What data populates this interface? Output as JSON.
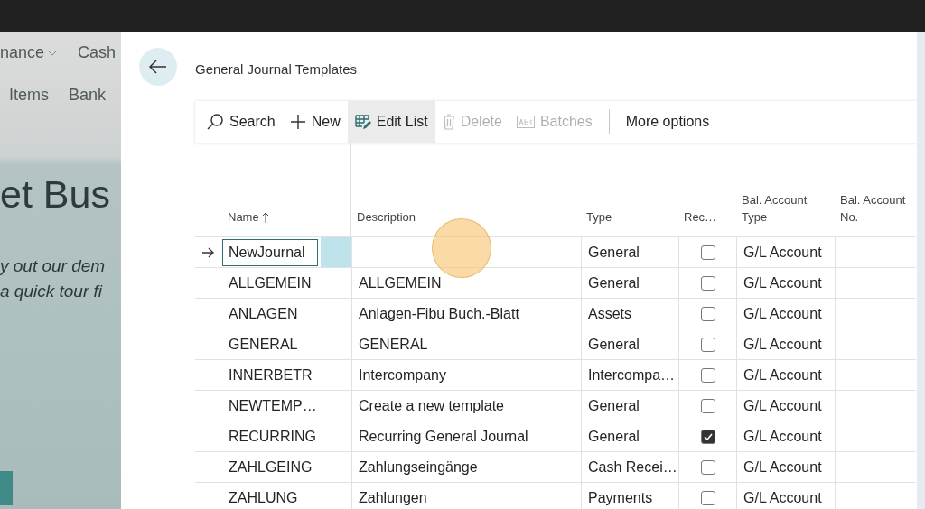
{
  "background": {
    "nav_top": [
      {
        "label": "nance",
        "dropdown": true
      },
      {
        "label": "Cash",
        "dropdown": false
      }
    ],
    "nav_bottom": [
      "Items",
      "Bank"
    ],
    "heading": "et Bus",
    "lines": [
      "y out our dem",
      "a quick tour fi"
    ]
  },
  "panel": {
    "title": "General Journal Templates",
    "toolbar": [
      {
        "label": "Search",
        "kind": "search",
        "disabled": false,
        "selected": false
      },
      {
        "label": "New",
        "kind": "new",
        "disabled": false,
        "selected": false
      },
      {
        "label": "Edit List",
        "kind": "edit",
        "disabled": false,
        "selected": true
      },
      {
        "label": "Delete",
        "kind": "delete",
        "disabled": true,
        "selected": false
      },
      {
        "label": "Batches",
        "kind": "batches",
        "disabled": true,
        "selected": false
      },
      {
        "label": "More options",
        "kind": "more",
        "disabled": false,
        "selected": false
      }
    ],
    "columns": [
      {
        "label": "Name",
        "sorted": true
      },
      {
        "label": "Description",
        "sorted": false
      },
      {
        "label": "Type",
        "sorted": false
      },
      {
        "label": "Rec…",
        "sorted": false
      },
      {
        "label": "Bal. Account Type",
        "sorted": false
      },
      {
        "label": "Bal. Account No.",
        "sorted": false
      }
    ],
    "rows": [
      {
        "current": true,
        "name": "NewJournal",
        "type": "General",
        "recurring": false,
        "bal_account_type": "G/L Account"
      },
      {
        "current": false,
        "name": "ALLGEMEIN",
        "description": "ALLGEMEIN",
        "type": "General",
        "recurring": false,
        "bal_account_type": "G/L Account"
      },
      {
        "current": false,
        "name": "ANLAGEN",
        "description": "Anlagen-Fibu Buch.-Blatt",
        "type": "Assets",
        "recurring": false,
        "bal_account_type": "G/L Account"
      },
      {
        "current": false,
        "name": "GENERAL",
        "description": "GENERAL",
        "type": "General",
        "recurring": false,
        "bal_account_type": "G/L Account"
      },
      {
        "current": false,
        "name": "INNERBETR",
        "description": "Intercompany",
        "type": "Intercompa…",
        "recurring": false,
        "bal_account_type": "G/L Account"
      },
      {
        "current": false,
        "name": "NEWTEMP…",
        "description": "Create a new template",
        "type": "General",
        "recurring": false,
        "bal_account_type": "G/L Account"
      },
      {
        "current": false,
        "name": "RECURRING",
        "description": "Recurring General Journal",
        "type": "General",
        "recurring": true,
        "bal_account_type": "G/L Account"
      },
      {
        "current": false,
        "name": "ZAHLGEING",
        "description": "Zahlungseingänge",
        "type": "Cash Recei…",
        "recurring": false,
        "bal_account_type": "G/L Account"
      },
      {
        "current": false,
        "name": "ZAHLUNG",
        "description": "Zahlungen",
        "type": "Payments",
        "recurring": false,
        "bal_account_type": "G/L Account"
      }
    ]
  }
}
